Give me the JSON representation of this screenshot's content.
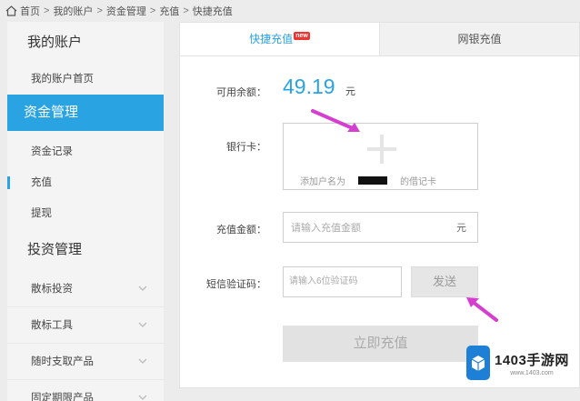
{
  "breadcrumb": {
    "items": [
      "首页",
      "我的账户",
      "资金管理",
      "充值",
      "快捷充值"
    ],
    "separator": ">"
  },
  "sidebar": {
    "section_account": "我的账户",
    "item_account_home": "我的账户首页",
    "section_funds": "资金管理",
    "item_fund_records": "资金记录",
    "item_recharge": "充值",
    "item_withdraw": "提现",
    "section_invest": "投资管理",
    "collapsibles": [
      "散标投资",
      "散标工具",
      "随时支取产品",
      "固定期限产品"
    ]
  },
  "tabs": {
    "quick": "快捷充值",
    "quick_badge": "new",
    "bank": "网银充值"
  },
  "form": {
    "balance_label": "可用余额：",
    "balance_value": "49.19",
    "balance_unit": "元",
    "card_label": "银行卡：",
    "card_hint_prefix": "添加户名为",
    "card_hint_suffix": "的借记卡",
    "amount_label": "充值金额：",
    "amount_placeholder": "请输入充值金额",
    "amount_unit": "元",
    "sms_label": "短信验证码：",
    "sms_placeholder": "请输入6位验证码",
    "send_button": "发送",
    "submit_button": "立即充值"
  },
  "watermark": {
    "title": "1403手游网",
    "url": "www.1403.com"
  },
  "colors": {
    "accent": "#2aa3e3",
    "arrow": "#d43fd0",
    "badge": "#e33333"
  }
}
